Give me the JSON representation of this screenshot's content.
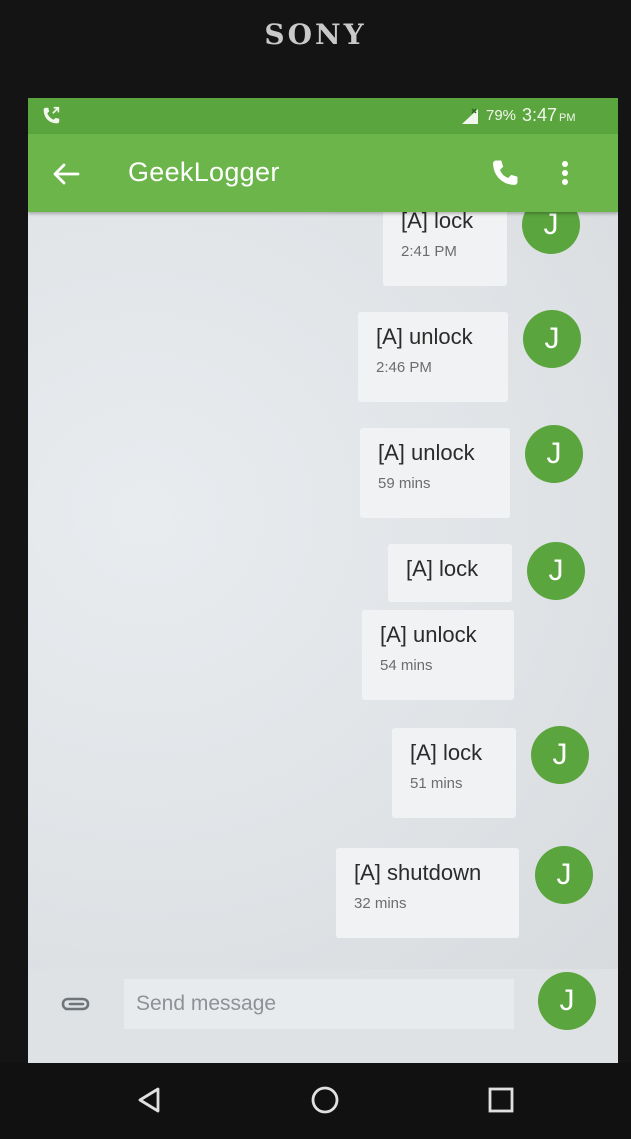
{
  "device": {
    "brand": "SONY"
  },
  "status_bar": {
    "battery": "79%",
    "time": "3:47",
    "ampm": "PM"
  },
  "toolbar": {
    "title": "GeekLogger"
  },
  "messages": [
    {
      "text": "[A] lock",
      "timestamp": "2:41 PM",
      "avatar": "J"
    },
    {
      "text": "[A] unlock",
      "timestamp": "2:46 PM",
      "avatar": "J"
    },
    {
      "text": "[A] unlock",
      "timestamp": "59 mins",
      "avatar": "J"
    },
    {
      "text": "[A] lock",
      "timestamp": "",
      "avatar": "J"
    },
    {
      "text": "[A] unlock",
      "timestamp": "54 mins",
      "avatar": ""
    },
    {
      "text": "[A] lock",
      "timestamp": "51 mins",
      "avatar": "J"
    },
    {
      "text": "[A] shutdown",
      "timestamp": "32 mins",
      "avatar": "J"
    }
  ],
  "composer": {
    "placeholder": "Send message",
    "avatar": "J"
  },
  "icons": {
    "status": "phone-forward-icon",
    "back": "arrow-left-icon",
    "call": "phone-icon",
    "more": "more-vert-icon",
    "attach": "paperclip-icon",
    "nav": [
      "back-triangle-icon",
      "home-circle-icon",
      "recents-square-icon"
    ]
  },
  "colors": {
    "toolbar": "#6cb54a",
    "status_bar": "#5aa53d",
    "avatar": "#5aa53d",
    "bubble": "#f1f2f3"
  }
}
